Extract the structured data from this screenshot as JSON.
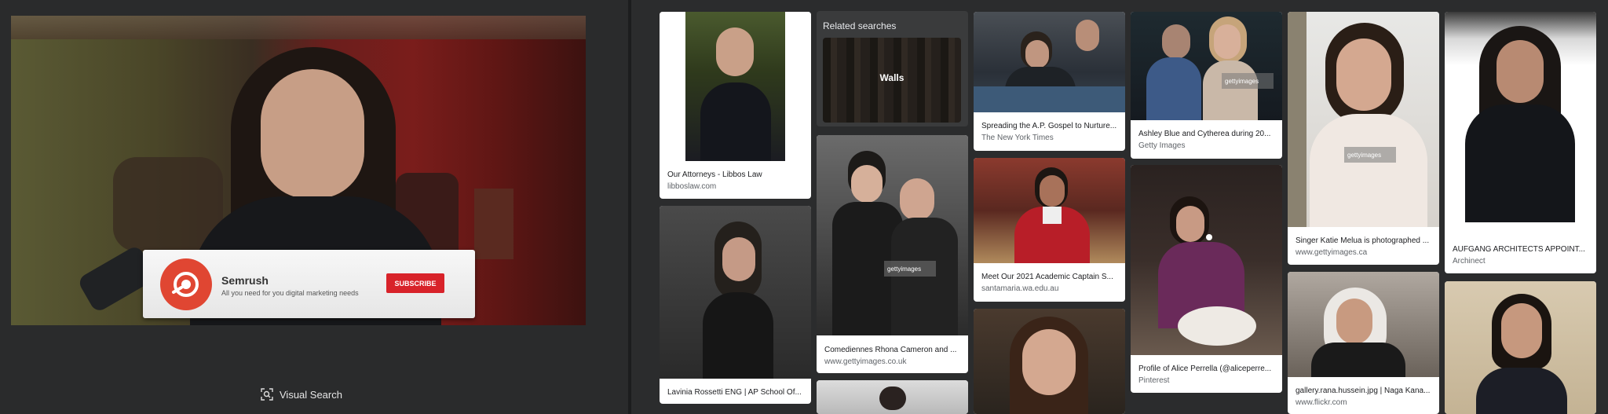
{
  "video": {
    "ad_name": "Semrush",
    "ad_tagline": "All you need for you digital marketing needs",
    "subscribe_label": "SUBSCRIBE",
    "colors": {
      "accent": "#d8232a",
      "logo": "#e04632"
    }
  },
  "visual_search": {
    "label": "Visual Search",
    "icon": "visual-search-icon"
  },
  "related_searches": {
    "title": "Related searches",
    "items": [
      {
        "label": "Walls"
      }
    ]
  },
  "results": [
    {
      "caption": "Our Attorneys - Libbos Law",
      "source": "libboslaw.com"
    },
    {
      "caption": "Lavinia Rossetti ENG | AP School Of...",
      "source": ""
    },
    {
      "caption": "Comediennes Rhona Cameron and ...",
      "source": "www.gettyimages.co.uk"
    },
    {
      "caption": "Spreading the A.P. Gospel to Nurture...",
      "source": "The New York Times"
    },
    {
      "caption": "Meet Our 2021 Academic Captain S...",
      "source": "santamaria.wa.edu.au"
    },
    {
      "caption": "Ashley Blue and Cytherea during 20...",
      "source": "Getty Images"
    },
    {
      "caption": "Profile of Alice Perrella (@aliceperre...",
      "source": "Pinterest"
    },
    {
      "caption": "Singer Katie Melua is photographed ...",
      "source": "www.gettyimages.ca"
    },
    {
      "caption": "gallery.rana.hussein.jpg | Naga Kana...",
      "source": "www.flickr.com"
    },
    {
      "caption": "AUFGANG ARCHITECTS APPOINT...",
      "source": "Archinect"
    }
  ],
  "watermarks": {
    "getty": "gettyimages"
  }
}
